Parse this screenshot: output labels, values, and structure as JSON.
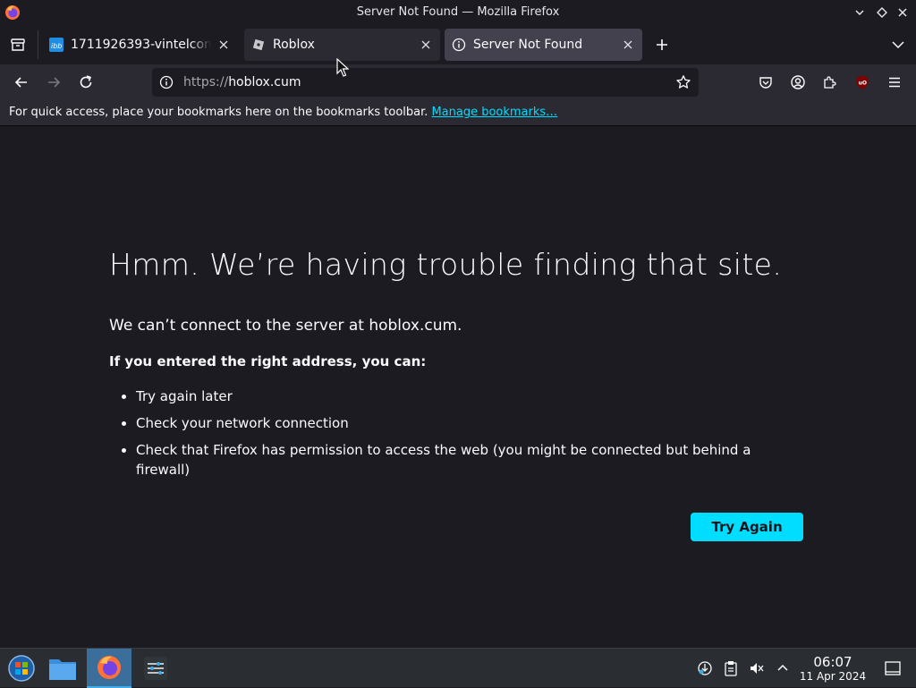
{
  "window": {
    "title": "Server Not Found — Mozilla Firefox"
  },
  "tabs": [
    {
      "label": "1711926393-vintelcomp",
      "favicon": "ibb-favicon",
      "active": false
    },
    {
      "label": "Roblox",
      "favicon": "roblox-favicon",
      "active": false
    },
    {
      "label": "Server Not Found",
      "favicon": "info-icon",
      "active": true
    }
  ],
  "urlbar": {
    "scheme": "https://",
    "host": "hoblox.cum"
  },
  "bookmarks_bar": {
    "message": "For quick access, place your bookmarks here on the bookmarks toolbar.",
    "link": "Manage bookmarks…"
  },
  "error_page": {
    "title": "Hmm. We’re having trouble finding that site.",
    "description": "We can’t connect to the server at hoblox.cum.",
    "lead": "If you entered the right address, you can:",
    "suggestions": [
      "Try again later",
      "Check your network connection",
      "Check that Firefox has permission to access the web (you might be connected but behind a firewall)"
    ],
    "button": "Try Again"
  },
  "taskbar": {
    "time": "06:07",
    "date": "11 Apr 2024"
  },
  "colors": {
    "accent": "#00ddff",
    "background": "#1c1b22",
    "toolbar": "#2b2a33"
  }
}
